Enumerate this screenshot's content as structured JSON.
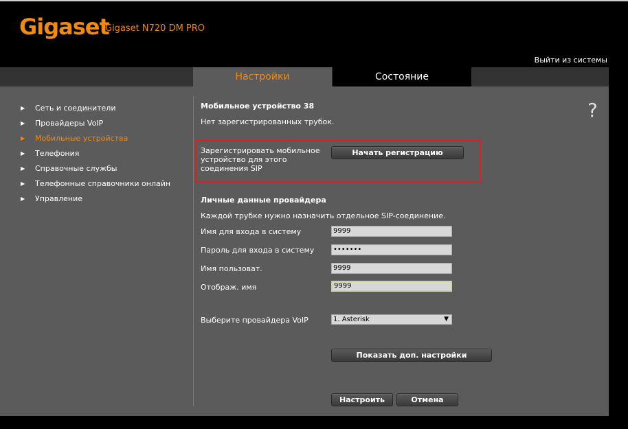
{
  "header": {
    "logo": "Gigaset",
    "model": "Gigaset N720 DM PRO",
    "logout": "Выйти из системы"
  },
  "tabs": [
    {
      "label": "Настройки",
      "active": true
    },
    {
      "label": "Состояние",
      "active": false
    }
  ],
  "sidebar": {
    "items": [
      {
        "label": "Сеть и соединители"
      },
      {
        "label": "Провайдеры VoIP"
      },
      {
        "label": "Мобильные устройства",
        "active": true
      },
      {
        "label": "Телефония"
      },
      {
        "label": "Справочные службы"
      },
      {
        "label": "Телефонные справочники онлайн"
      },
      {
        "label": "Управление"
      }
    ]
  },
  "main": {
    "title": "Мобильное устройство 38",
    "no_handsets": "Нет зарегистрированных трубок.",
    "register_label": "Зарегистрировать мобильное устройство для этого соединения SIP",
    "register_button": "Начать регистрацию",
    "provider_title": "Личные данные провайдера",
    "provider_note": "Каждой трубке нужно назначить отдельное SIP-соединение.",
    "fields": {
      "login_name": {
        "label": "Имя для входа в систему",
        "value": "9999"
      },
      "password": {
        "label": "Пароль для входа в систему",
        "value": "•••••••"
      },
      "user_name": {
        "label": "Имя пользоват.",
        "value": "9999"
      },
      "display_name": {
        "label": "Отображ. имя",
        "value": "9999"
      }
    },
    "provider_select": {
      "label": "Выберите провайдера VoIP",
      "value": "1. Asterisk"
    },
    "advanced_button": "Показать доп. настройки",
    "apply_button": "Настроить",
    "cancel_button": "Отмена"
  },
  "help_icon": "?",
  "colors": {
    "accent": "#f08a10",
    "panel": "#5b5b5b",
    "highlight_box": "#e01f1f"
  }
}
